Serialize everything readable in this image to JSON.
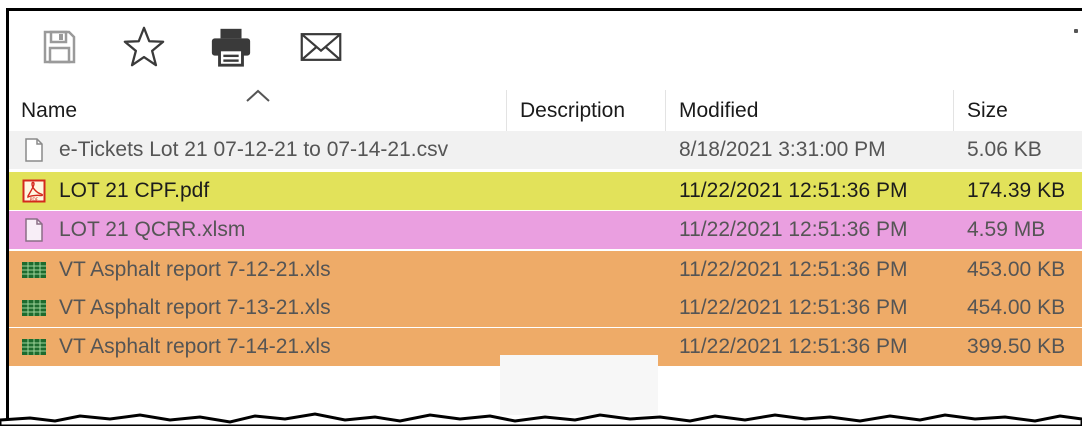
{
  "toolbar": {
    "buttons": [
      {
        "icon": "save-icon"
      },
      {
        "icon": "star-icon"
      },
      {
        "icon": "printer-icon"
      },
      {
        "icon": "mail-icon"
      }
    ]
  },
  "columns": {
    "name": "Name",
    "description": "Description",
    "modified": "Modified",
    "size": "Size"
  },
  "files": [
    {
      "name": "e-Tickets Lot 21 07-12-21 to 07-14-21.csv",
      "modified": "8/18/2021 3:31:00 PM",
      "size": "5.06 KB",
      "icon": "document-icon",
      "highlight": "#f1f1f1"
    },
    {
      "name": "LOT 21 CPF.pdf",
      "modified": "11/22/2021 12:51:36 PM",
      "size": "174.39 KB",
      "icon": "pdf-icon",
      "highlight": "#e2e25a"
    },
    {
      "name": "LOT 21 QCRR.xlsm",
      "modified": "11/22/2021 12:51:36 PM",
      "size": "4.59 MB",
      "icon": "document-icon",
      "highlight": "#ea9fe0"
    },
    {
      "name": "VT Asphalt report 7-12-21.xls",
      "modified": "11/22/2021 12:51:36 PM",
      "size": "453.00 KB",
      "icon": "spreadsheet-icon",
      "highlight": "#eeab68"
    },
    {
      "name": "VT Asphalt report 7-13-21.xls",
      "modified": "11/22/2021 12:51:36 PM",
      "size": "454.00 KB",
      "icon": "spreadsheet-icon",
      "highlight": "#eeab68"
    },
    {
      "name": "VT Asphalt report 7-14-21.xls",
      "modified": "11/22/2021 12:51:36 PM",
      "size": "399.50 KB",
      "icon": "spreadsheet-icon",
      "highlight": "#eeab68"
    }
  ]
}
